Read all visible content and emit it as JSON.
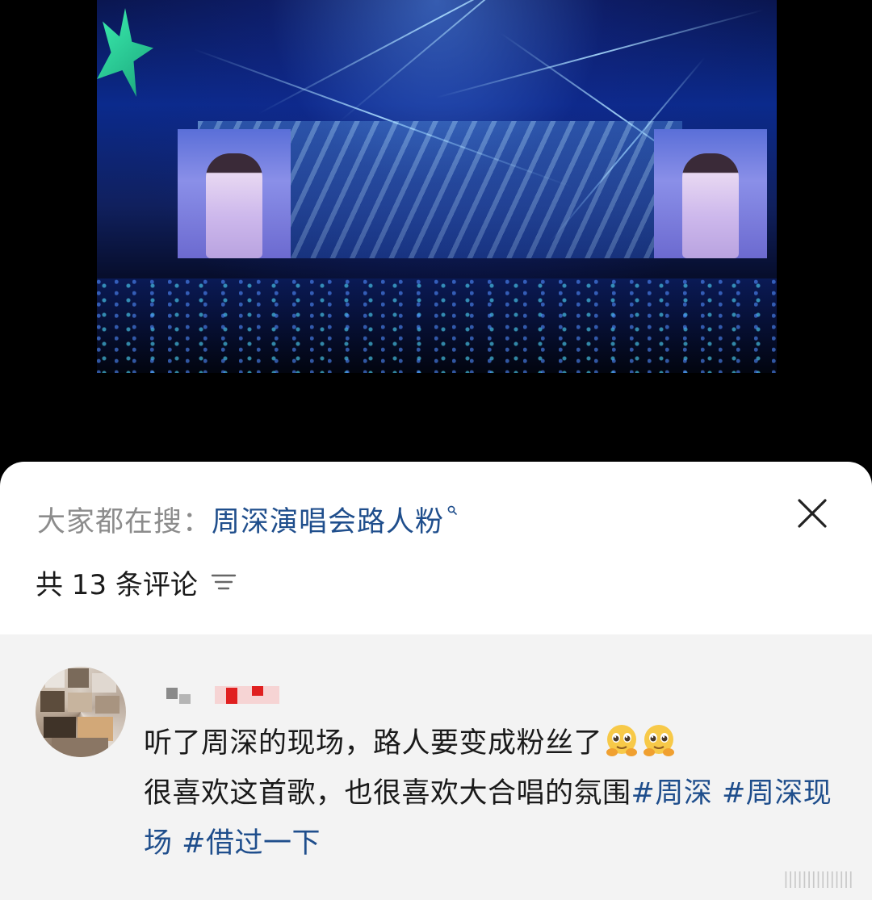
{
  "search_bar": {
    "prefix": "大家都在搜：",
    "keyword": "周深演唱会路人粉"
  },
  "comments_header": {
    "count_label": "共 13 条评论"
  },
  "comment": {
    "text_line1": "听了周深的现场，路人要变成粉丝了",
    "text_line2_plain": "很喜欢这首歌，也很喜欢大合唱的氛围",
    "hashtags": [
      "#周深",
      "#周深现场",
      "#借过一下"
    ],
    "emoji_count": 2
  },
  "colors": {
    "accent_link": "#1f4e8c",
    "muted_text": "#8c8c8c",
    "comments_bg": "#f3f3f3"
  },
  "icons": [
    "search-icon",
    "close-icon",
    "sort-icon",
    "teary-hug-emoji"
  ]
}
